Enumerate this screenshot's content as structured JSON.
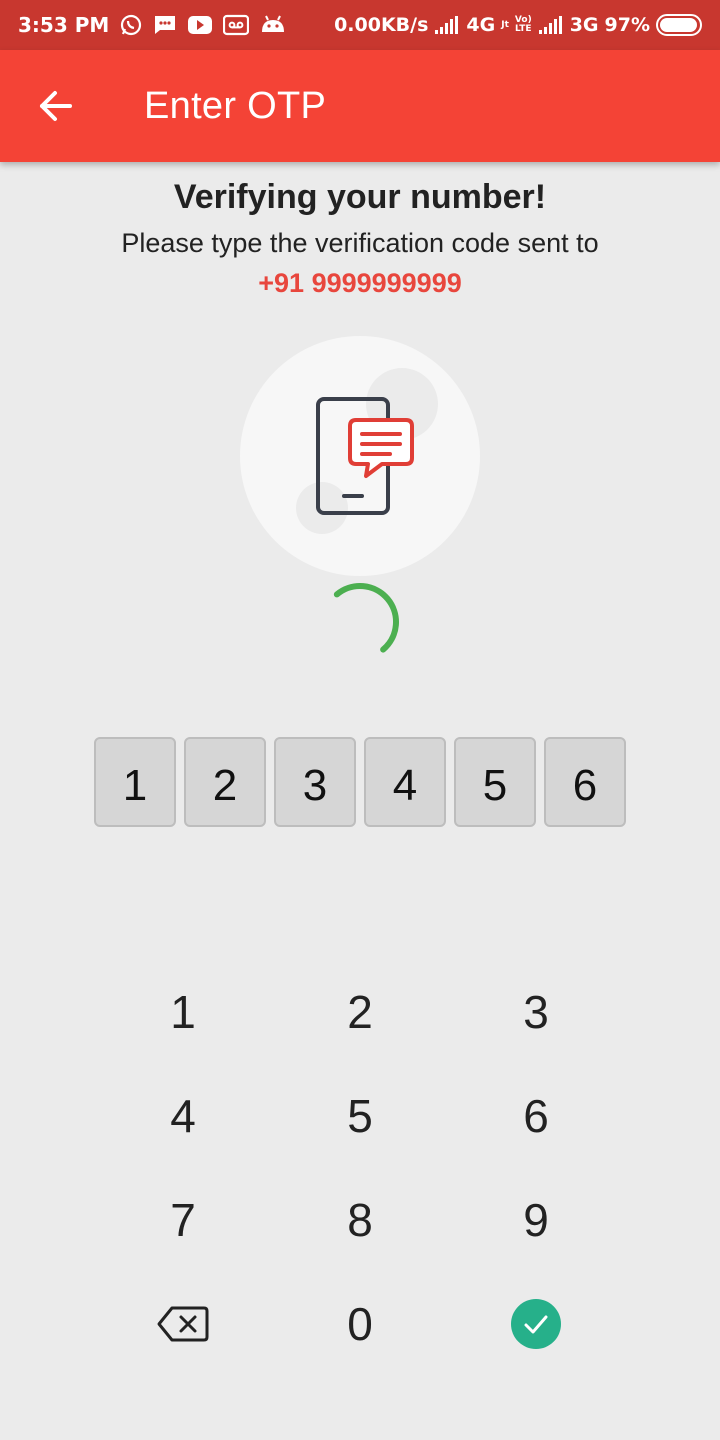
{
  "status_bar": {
    "time": "3:53 PM",
    "speed": "0.00KB/s",
    "network1": "4G",
    "network1_sub": "Jt",
    "volte_top": "Vo)",
    "volte_bottom": "LTE",
    "network2": "3G",
    "battery": "97%",
    "battery_level": 0.97,
    "icons": [
      "whatsapp-icon",
      "sms-icon",
      "youtube-icon",
      "voicemail-icon",
      "android-icon",
      "signal-icon",
      "signal-icon",
      "battery-icon"
    ]
  },
  "app_bar": {
    "title": "Enter OTP",
    "back_icon": "arrow-left-icon"
  },
  "header": {
    "heading": "Verifying your number!",
    "subtext": "Please type the verification code sent to",
    "phone": "+91 9999999999"
  },
  "illustration": {
    "icon": "phone-message-icon"
  },
  "otp": {
    "digits": [
      "1",
      "2",
      "3",
      "4",
      "5",
      "6"
    ]
  },
  "keypad": {
    "keys": [
      "1",
      "2",
      "3",
      "4",
      "5",
      "6",
      "7",
      "8",
      "9",
      "0"
    ],
    "backspace_icon": "backspace-icon",
    "confirm_icon": "check-icon"
  },
  "colors": {
    "app_bar": "#f44336",
    "status_bar": "#c8372f",
    "accent_text": "#e8463d",
    "spinner": "#4caf50",
    "confirm": "#26b08a",
    "background": "#ebebeb"
  }
}
